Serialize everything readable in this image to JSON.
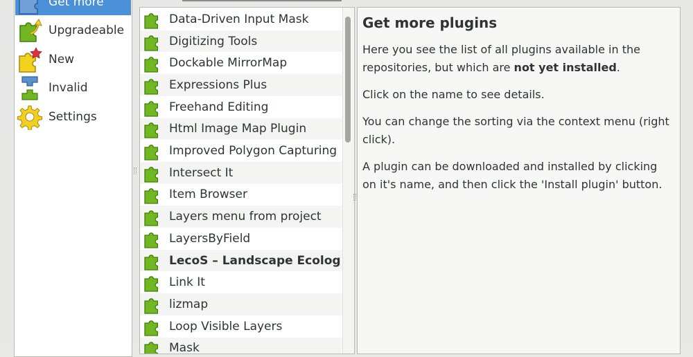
{
  "categories": [
    {
      "label": "Get more",
      "icon": "puzzle-piece-icon",
      "selected": true
    },
    {
      "label": "Upgradeable",
      "icon": "upgrade-arrows-icon",
      "selected": false
    },
    {
      "label": "New",
      "icon": "new-star-puzzle-icon",
      "selected": false
    },
    {
      "label": "Invalid",
      "icon": "broken-plugin-icon",
      "selected": false
    },
    {
      "label": "Settings",
      "icon": "gear-icon",
      "selected": false
    }
  ],
  "plugins": [
    {
      "name": "Data-Driven Input Mask",
      "bold": false
    },
    {
      "name": "Digitizing Tools",
      "bold": false
    },
    {
      "name": "Dockable MirrorMap",
      "bold": false
    },
    {
      "name": "Expressions Plus",
      "bold": false
    },
    {
      "name": "Freehand Editing",
      "bold": false
    },
    {
      "name": "Html Image Map Plugin",
      "bold": false
    },
    {
      "name": "Improved Polygon Capturing",
      "bold": false
    },
    {
      "name": "Intersect It",
      "bold": false
    },
    {
      "name": "Item Browser",
      "bold": false
    },
    {
      "name": "Layers menu from project",
      "bold": false
    },
    {
      "name": "LayersByField",
      "bold": false
    },
    {
      "name": "LecoS – Landscape Ecolog...",
      "bold": true
    },
    {
      "name": "Link It",
      "bold": false
    },
    {
      "name": "lizmap",
      "bold": false
    },
    {
      "name": "Loop Visible Layers",
      "bold": false
    },
    {
      "name": "Mask",
      "bold": false
    }
  ],
  "details": {
    "title": "Get more plugins",
    "p1_text": "Here you see the list of all plugins available in the repositories, but which are ",
    "p1_bold": "not yet installed",
    "p1_end": ".",
    "p2": "Click on the name to see details.",
    "p3": "You can change the sorting via the context menu (right click).",
    "p4": "A plugin can be downloaded and installed by clicking on it's name, and then click the 'Install plugin' button."
  },
  "colors": {
    "selection": "#4a90d9",
    "puzzle_green": "#73b623",
    "puzzle_dark": "#3f7f0f"
  }
}
